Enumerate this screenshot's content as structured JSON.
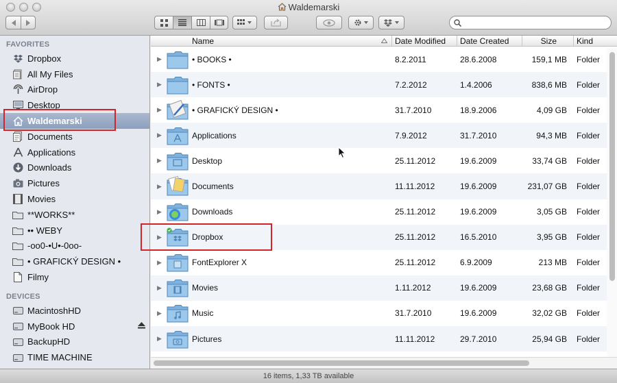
{
  "window": {
    "title": "Waldemarski"
  },
  "toolbar": {
    "search": {
      "value": "",
      "placeholder": ""
    }
  },
  "sidebar": {
    "favorites_header": "FAVORITES",
    "favorites": [
      {
        "label": "Dropbox",
        "icon": "dropbox-icon"
      },
      {
        "label": "All My Files",
        "icon": "all-files-icon"
      },
      {
        "label": "AirDrop",
        "icon": "airdrop-icon"
      },
      {
        "label": "Desktop",
        "icon": "desktop-icon"
      },
      {
        "label": "Waldemarski",
        "icon": "home-icon",
        "selected": true
      },
      {
        "label": "Documents",
        "icon": "documents-icon"
      },
      {
        "label": "Applications",
        "icon": "applications-icon"
      },
      {
        "label": "Downloads",
        "icon": "downloads-icon"
      },
      {
        "label": "Pictures",
        "icon": "pictures-icon"
      },
      {
        "label": "Movies",
        "icon": "movies-icon"
      },
      {
        "label": "**WORKS**",
        "icon": "folder-icon"
      },
      {
        "label": "•• WEBY",
        "icon": "folder-icon"
      },
      {
        "label": "-oo0-•U•-0oo-",
        "icon": "folder-icon"
      },
      {
        "label": "• GRAFICKÝ DESIGN •",
        "icon": "folder-icon"
      },
      {
        "label": "Filmy",
        "icon": "document-icon"
      }
    ],
    "devices_header": "DEVICES",
    "devices": [
      {
        "label": "MacintoshHD",
        "icon": "hard-drive-icon"
      },
      {
        "label": "MyBook HD",
        "icon": "hard-drive-icon",
        "eject": true
      },
      {
        "label": "BackupHD",
        "icon": "hard-drive-icon"
      },
      {
        "label": "TIME MACHINE",
        "icon": "hard-drive-icon"
      }
    ]
  },
  "columns": {
    "name": "Name",
    "modified": "Date Modified",
    "created": "Date Created",
    "size": "Size",
    "kind": "Kind"
  },
  "files": [
    {
      "name": "• BOOKS •",
      "modified": "8.2.2011",
      "created": "28.6.2008",
      "size": "159,1 MB",
      "kind": "Folder",
      "icon": "folder-icon"
    },
    {
      "name": "• FONTS •",
      "modified": "7.2.2012",
      "created": "1.4.2006",
      "size": "838,6 MB",
      "kind": "Folder",
      "icon": "folder-icon"
    },
    {
      "name": "• GRAFICKÝ DESIGN •",
      "modified": "31.7.2010",
      "created": "18.9.2006",
      "size": "4,09 GB",
      "kind": "Folder",
      "icon": "design-folder-icon"
    },
    {
      "name": "Applications",
      "modified": "7.9.2012",
      "created": "31.7.2010",
      "size": "94,3 MB",
      "kind": "Folder",
      "icon": "applications-folder-icon"
    },
    {
      "name": "Desktop",
      "modified": "25.11.2012",
      "created": "19.6.2009",
      "size": "33,74 GB",
      "kind": "Folder",
      "icon": "desktop-folder-icon"
    },
    {
      "name": "Documents",
      "modified": "11.11.2012",
      "created": "19.6.2009",
      "size": "231,07 GB",
      "kind": "Folder",
      "icon": "documents-folder-icon"
    },
    {
      "name": "Downloads",
      "modified": "25.11.2012",
      "created": "19.6.2009",
      "size": "3,05 GB",
      "kind": "Folder",
      "icon": "downloads-folder-icon"
    },
    {
      "name": "Dropbox",
      "modified": "25.11.2012",
      "created": "16.5.2010",
      "size": "3,95 GB",
      "kind": "Folder",
      "icon": "dropbox-folder-icon"
    },
    {
      "name": "FontExplorer X",
      "modified": "25.11.2012",
      "created": "6.9.2009",
      "size": "213 MB",
      "kind": "Folder",
      "icon": "fontexplorer-folder-icon"
    },
    {
      "name": "Movies",
      "modified": "1.11.2012",
      "created": "19.6.2009",
      "size": "23,68 GB",
      "kind": "Folder",
      "icon": "movies-folder-icon"
    },
    {
      "name": "Music",
      "modified": "31.7.2010",
      "created": "19.6.2009",
      "size": "32,02 GB",
      "kind": "Folder",
      "icon": "music-folder-icon"
    },
    {
      "name": "Pictures",
      "modified": "11.11.2012",
      "created": "29.7.2010",
      "size": "25,94 GB",
      "kind": "Folder",
      "icon": "pictures-folder-icon"
    }
  ],
  "status": {
    "text": "16 items, 1,33 TB available"
  },
  "colors": {
    "highlight_box": "#d2232a",
    "selection": "#8c9fbd",
    "folder_blue": "#6fa6d6"
  }
}
